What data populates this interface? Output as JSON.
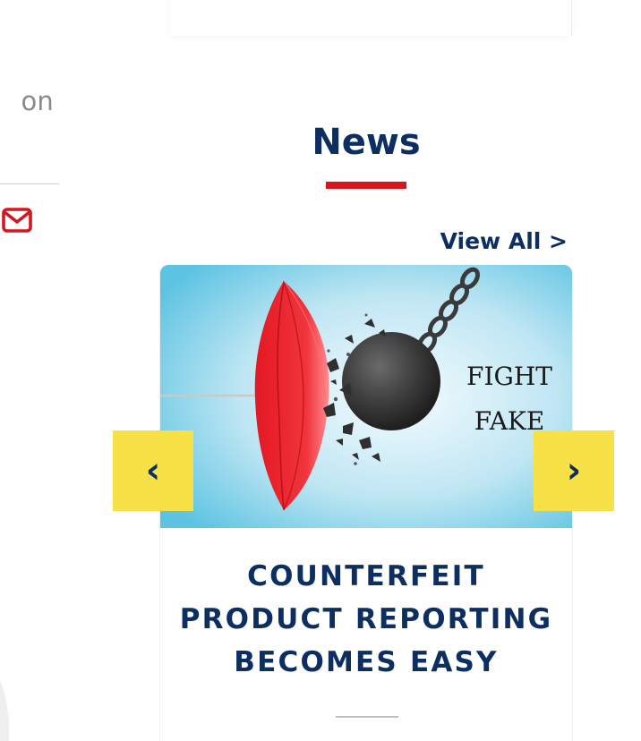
{
  "left_column": {
    "heading_fragment": "on",
    "email_icon": "envelope-icon"
  },
  "news": {
    "title": "News",
    "view_all": "View All >",
    "accent_color": "#d3161f",
    "title_color": "#0c2e60"
  },
  "card": {
    "image_text_line1": "FIGHT",
    "image_text_line2": "FAKE",
    "title": "COUNTERFEIT PRODUCT REPORTING BECOMES EASY"
  },
  "carousel": {
    "prev_label": "‹",
    "next_label": "›",
    "arrow_color": "#f7e146"
  }
}
